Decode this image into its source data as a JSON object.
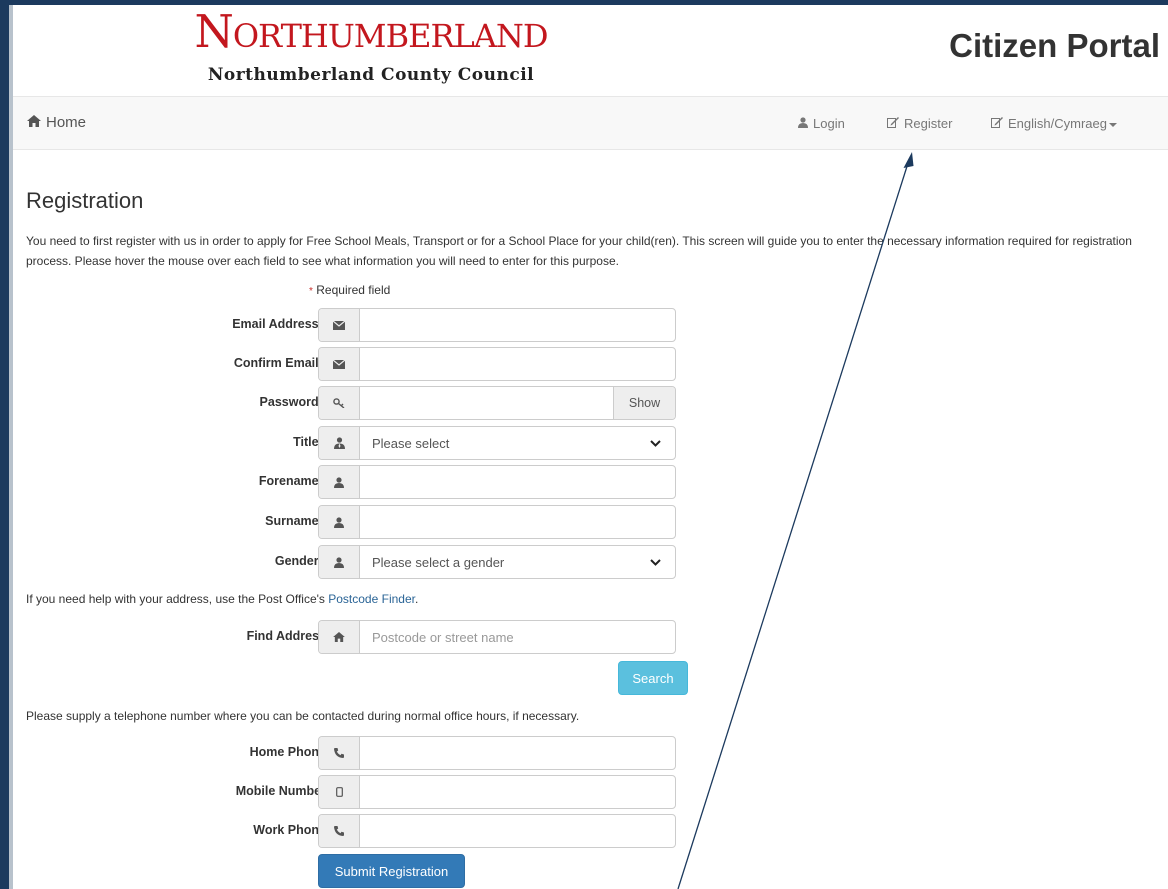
{
  "header": {
    "logo_text": "Northumberland",
    "logo_sub": "Northumberland County Council",
    "portal_title": "Citizen Portal"
  },
  "nav": {
    "home": "Home",
    "login": "Login",
    "register": "Register",
    "language": "English/Cymraeg"
  },
  "main": {
    "title": "Registration",
    "intro": "You need to first register with us in order to apply for Free School Meals, Transport or for a School Place for your child(ren). This screen will guide you to enter the necessary information required for registration process. Please hover the mouse over each field to see what information you will need to enter for this purpose.",
    "required_note": "Required field",
    "required_star": "*"
  },
  "form": {
    "email_label": "Email Address",
    "confirm_email_label": "Confirm Email",
    "password_label": "Password",
    "password_show": "Show",
    "title_label": "Title",
    "title_value": "Please select",
    "forename_label": "Forename",
    "surname_label": "Surname",
    "gender_label": "Gender",
    "gender_value": "Please select a gender",
    "address_help_prefix": "If you need help with your address, use the Post Office's ",
    "address_help_link": "Postcode Finder",
    "address_help_suffix": ".",
    "find_address_label": "Find Address",
    "find_address_placeholder": "Postcode or street name",
    "search_button": "Search",
    "phone_help": "Please supply a telephone number where you can be contacted during normal office hours, if necessary.",
    "home_phone_label": "Home Phone",
    "mobile_label": "Mobile Number",
    "work_phone_label": "Work Phone",
    "submit_button": "Submit Registration"
  },
  "icons": {
    "home": "home-icon",
    "user": "user-icon",
    "edit": "edit-icon",
    "envelope": "envelope-icon",
    "key": "key-icon",
    "phone": "phone-icon",
    "mobile": "mobile-icon"
  },
  "colors": {
    "brand_red": "#c3171e",
    "primary": "#337ab7",
    "info": "#5bc0de",
    "frame": "#1c3a5e",
    "required": "#c9302c"
  }
}
